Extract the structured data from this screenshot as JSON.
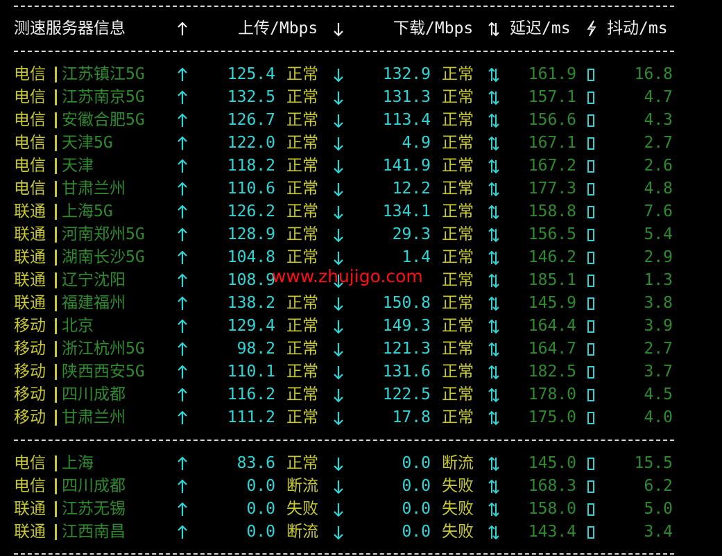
{
  "colors": {
    "background": "#000000",
    "header_text": "#f0f0f0",
    "isp": "#c8c832",
    "location": "#2e8b2e",
    "arrow": "#2fd6d6",
    "speed": "#2fd6d6",
    "status": "#c8c832",
    "latency": "#2e8b2e",
    "jitter": "#2e8b2e",
    "watermark": "#ff1010"
  },
  "header": {
    "node": "测速服务器信息",
    "upload": "上传/Mbps",
    "download": "下载/Mbps",
    "latency": "延迟/ms",
    "jitter": "抖动/ms"
  },
  "icons": {
    "upload": "up-arrow-icon",
    "download": "down-arrow-icon",
    "latency": "up-down-arrow-icon",
    "jitter": "lightning-icon",
    "row_marker": "box-glyph-icon"
  },
  "groups": [
    {
      "rows": [
        {
          "isp": "电信",
          "location": "江苏镇江5G",
          "up": "125.4",
          "up_status": "正常",
          "down": "132.9",
          "down_status": "正常",
          "latency": "161.9",
          "jitter": "16.8"
        },
        {
          "isp": "电信",
          "location": "江苏南京5G",
          "up": "132.5",
          "up_status": "正常",
          "down": "131.3",
          "down_status": "正常",
          "latency": "157.1",
          "jitter": "4.7"
        },
        {
          "isp": "电信",
          "location": "安徽合肥5G",
          "up": "126.7",
          "up_status": "正常",
          "down": "113.4",
          "down_status": "正常",
          "latency": "156.6",
          "jitter": "4.3"
        },
        {
          "isp": "电信",
          "location": "天津5G",
          "up": "122.0",
          "up_status": "正常",
          "down": "4.9",
          "down_status": "正常",
          "latency": "167.1",
          "jitter": "2.7"
        },
        {
          "isp": "电信",
          "location": "天津",
          "up": "118.2",
          "up_status": "正常",
          "down": "141.9",
          "down_status": "正常",
          "latency": "167.2",
          "jitter": "2.6"
        },
        {
          "isp": "电信",
          "location": "甘肃兰州",
          "up": "110.6",
          "up_status": "正常",
          "down": "12.2",
          "down_status": "正常",
          "latency": "177.3",
          "jitter": "4.8"
        },
        {
          "isp": "联通",
          "location": "上海5G",
          "up": "126.2",
          "up_status": "正常",
          "down": "134.1",
          "down_status": "正常",
          "latency": "158.8",
          "jitter": "7.6"
        },
        {
          "isp": "联通",
          "location": "河南郑州5G",
          "up": "128.9",
          "up_status": "正常",
          "down": "29.3",
          "down_status": "正常",
          "latency": "156.5",
          "jitter": "5.4"
        },
        {
          "isp": "联通",
          "location": "湖南长沙5G",
          "up": "104.8",
          "up_status": "正常",
          "down": "1.4",
          "down_status": "正常",
          "latency": "146.2",
          "jitter": "2.9"
        },
        {
          "isp": "联通",
          "location": "辽宁沈阳",
          "up": "108.9",
          "up_status": "",
          "down": "",
          "down_status": "正常",
          "latency": "185.1",
          "jitter": "1.3"
        },
        {
          "isp": "联通",
          "location": "福建福州",
          "up": "138.2",
          "up_status": "正常",
          "down": "150.8",
          "down_status": "正常",
          "latency": "145.9",
          "jitter": "3.8"
        },
        {
          "isp": "移动",
          "location": "北京",
          "up": "129.4",
          "up_status": "正常",
          "down": "149.3",
          "down_status": "正常",
          "latency": "164.4",
          "jitter": "3.9"
        },
        {
          "isp": "移动",
          "location": "浙江杭州5G",
          "up": "98.2",
          "up_status": "正常",
          "down": "121.3",
          "down_status": "正常",
          "latency": "164.7",
          "jitter": "2.7"
        },
        {
          "isp": "移动",
          "location": "陕西西安5G",
          "up": "110.1",
          "up_status": "正常",
          "down": "131.6",
          "down_status": "正常",
          "latency": "182.5",
          "jitter": "3.7"
        },
        {
          "isp": "移动",
          "location": "四川成都",
          "up": "116.2",
          "up_status": "正常",
          "down": "122.5",
          "down_status": "正常",
          "latency": "178.0",
          "jitter": "4.5"
        },
        {
          "isp": "移动",
          "location": "甘肃兰州",
          "up": "111.2",
          "up_status": "正常",
          "down": "17.8",
          "down_status": "正常",
          "latency": "175.0",
          "jitter": "4.0"
        }
      ]
    },
    {
      "rows": [
        {
          "isp": "电信",
          "location": "上海",
          "up": "83.6",
          "up_status": "正常",
          "down": "0.0",
          "down_status": "断流",
          "latency": "145.0",
          "jitter": "15.5"
        },
        {
          "isp": "电信",
          "location": "四川成都",
          "up": "0.0",
          "up_status": "断流",
          "down": "0.0",
          "down_status": "失败",
          "latency": "168.3",
          "jitter": "6.2"
        },
        {
          "isp": "联通",
          "location": "江苏无锡",
          "up": "0.0",
          "up_status": "失败",
          "down": "0.0",
          "down_status": "失败",
          "latency": "158.0",
          "jitter": "5.0"
        },
        {
          "isp": "联通",
          "location": "江西南昌",
          "up": "0.0",
          "up_status": "断流",
          "down": "0.0",
          "down_status": "失败",
          "latency": "143.4",
          "jitter": "3.4"
        }
      ]
    }
  ],
  "watermark": "www.zhujigo.com"
}
